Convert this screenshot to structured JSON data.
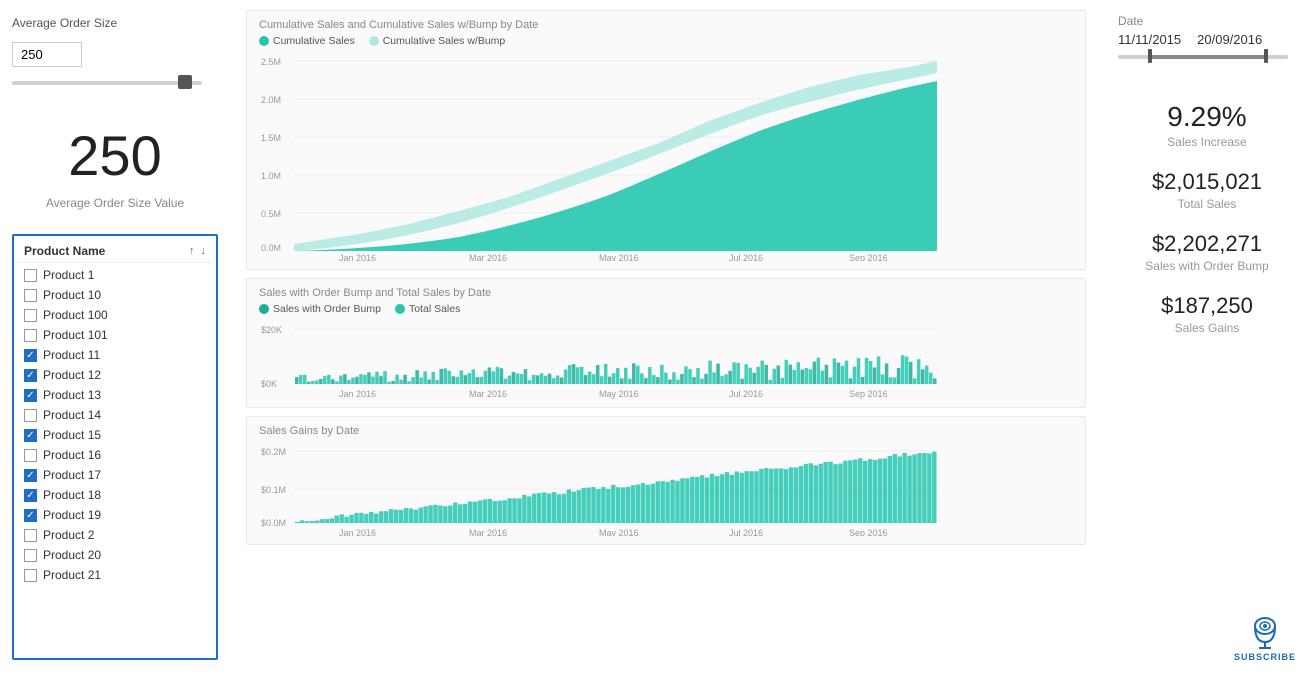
{
  "left": {
    "avg_order_title": "Average Order Size",
    "avg_order_value": "250",
    "big_number": "250",
    "big_number_label": "Average Order Size Value"
  },
  "slicer": {
    "header": "Product Name",
    "items": [
      {
        "label": "Product 1",
        "checked": false
      },
      {
        "label": "Product 10",
        "checked": false
      },
      {
        "label": "Product 100",
        "checked": false
      },
      {
        "label": "Product 101",
        "checked": false
      },
      {
        "label": "Product 11",
        "checked": true
      },
      {
        "label": "Product 12",
        "checked": true
      },
      {
        "label": "Product 13",
        "checked": true
      },
      {
        "label": "Product 14",
        "checked": false
      },
      {
        "label": "Product 15",
        "checked": true
      },
      {
        "label": "Product 16",
        "checked": false
      },
      {
        "label": "Product 17",
        "checked": true
      },
      {
        "label": "Product 18",
        "checked": true
      },
      {
        "label": "Product 19",
        "checked": true
      },
      {
        "label": "Product 2",
        "checked": false
      },
      {
        "label": "Product 20",
        "checked": false
      },
      {
        "label": "Product 21",
        "checked": false
      }
    ]
  },
  "chart1": {
    "title": "Cumulative Sales and Cumulative Sales w/Bump by Date",
    "legend": [
      {
        "label": "Cumulative Sales",
        "color": "#26c6b0"
      },
      {
        "label": "Cumulative Sales w/Bump",
        "color": "#aee8e0"
      }
    ],
    "y_labels": [
      "2.5M",
      "2.0M",
      "1.5M",
      "1.0M",
      "0.5M",
      "0.0M"
    ],
    "x_labels": [
      "Jan 2016",
      "Mar 2016",
      "May 2016",
      "Jul 2016",
      "Sep 2016"
    ]
  },
  "chart2": {
    "title": "Sales with Order Bump and Total Sales by Date",
    "legend": [
      {
        "label": "Sales with Order Bump",
        "color": "#1eac97"
      },
      {
        "label": "Total Sales",
        "color": "#26c6b0"
      }
    ],
    "y_labels": [
      "$20K",
      "$0K"
    ],
    "x_labels": [
      "Jan 2016",
      "Mar 2016",
      "May 2016",
      "Jul 2016",
      "Sep 2016"
    ]
  },
  "chart3": {
    "title": "Sales Gains by Date",
    "y_labels": [
      "$0.2M",
      "$0.1M",
      "$0.0M"
    ],
    "x_labels": [
      "Jan 2016",
      "Mar 2016",
      "May 2016",
      "Jul 2016",
      "Sep 2016"
    ]
  },
  "right": {
    "date_label": "Date",
    "date_from": "11/11/2015",
    "date_to": "20/09/2016",
    "sales_increase_value": "9.29%",
    "sales_increase_label": "Sales Increase",
    "total_sales_value": "$2,015,021",
    "total_sales_label": "Total Sales",
    "order_bump_value": "$2,202,271",
    "order_bump_label": "Sales with Order Bump",
    "sales_gains_value": "$187,250",
    "sales_gains_label": "Sales Gains",
    "subscribe_text": "SUBSCRIBE"
  }
}
